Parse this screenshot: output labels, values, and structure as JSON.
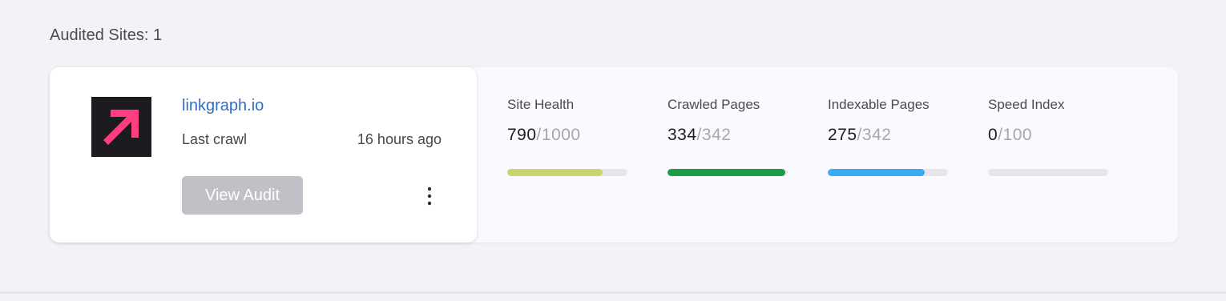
{
  "header": {
    "audited_sites_label": "Audited Sites: 1"
  },
  "site": {
    "domain": "linkgraph.io",
    "logo_icon": "arrow-up-right-icon",
    "logo_colors": {
      "background": "#1d1a20",
      "arrow": "#ff3d7f"
    },
    "last_crawl_label": "Last crawl",
    "last_crawl_time": "16 hours ago",
    "view_audit_label": "View Audit",
    "menu_icon": "vertical-ellipsis-icon"
  },
  "metrics": [
    {
      "label": "Site Health",
      "value": "790",
      "separator": "/",
      "total": "1000",
      "progress_pct": 79,
      "color": "#c9d46c"
    },
    {
      "label": "Crawled Pages",
      "value": "334",
      "separator": "/",
      "total": "342",
      "progress_pct": 97.7,
      "color": "#1f9a48"
    },
    {
      "label": "Indexable Pages",
      "value": "275",
      "separator": "/",
      "total": "342",
      "progress_pct": 80.4,
      "color": "#3aabf3"
    },
    {
      "label": "Speed Index",
      "value": "0",
      "separator": "/",
      "total": "100",
      "progress_pct": 0,
      "color": "#3aabf3"
    }
  ]
}
